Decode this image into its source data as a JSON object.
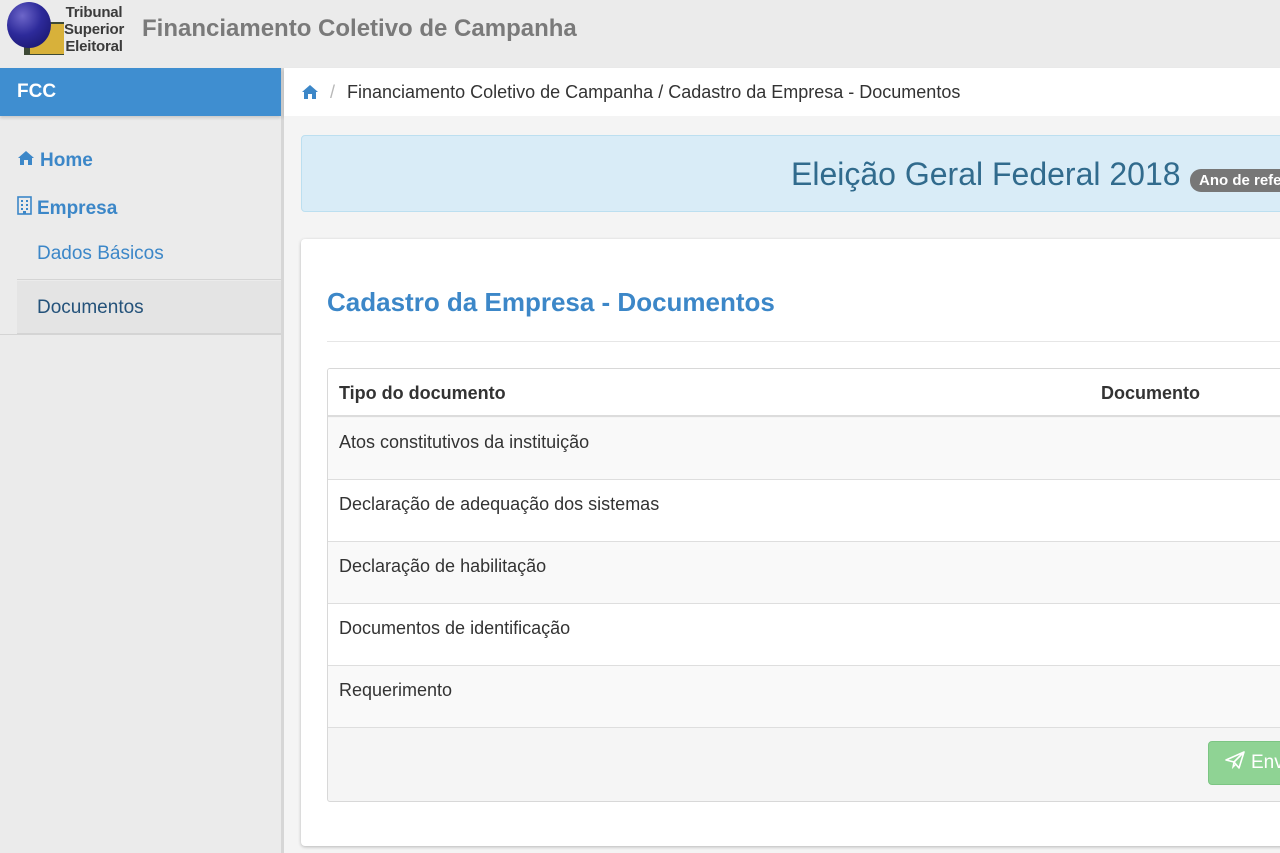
{
  "header": {
    "logo_text": "Tribunal\nSuperior\nEleitoral",
    "app_title": "Financiamento Coletivo de Campanha"
  },
  "sidebar": {
    "title": "FCC",
    "home_label": "Home",
    "empresa_label": "Empresa",
    "items": [
      {
        "label": "Dados Básicos"
      },
      {
        "label": "Documentos"
      }
    ]
  },
  "breadcrumb": {
    "path": "Financiamento Coletivo de Campanha / Cadastro da Empresa - Documentos"
  },
  "election": {
    "title": "Eleição Geral Federal 2018",
    "badge": "Ano de refe"
  },
  "panel": {
    "title": "Cadastro da Empresa - Documentos",
    "table": {
      "columns": [
        "Tipo do documento",
        "Documento"
      ],
      "rows": [
        {
          "tipo": "Atos constitutivos da instituição"
        },
        {
          "tipo": "Declaração de adequação dos sistemas"
        },
        {
          "tipo": "Declaração de habilitação"
        },
        {
          "tipo": "Documentos de identificação"
        },
        {
          "tipo": "Requerimento"
        }
      ]
    },
    "send_label": "Env"
  },
  "colors": {
    "brand_blue": "#3f8ed0",
    "link_blue": "#3c87c8",
    "success_disabled": "#8fd394",
    "info_bg": "#d9ecf7"
  }
}
